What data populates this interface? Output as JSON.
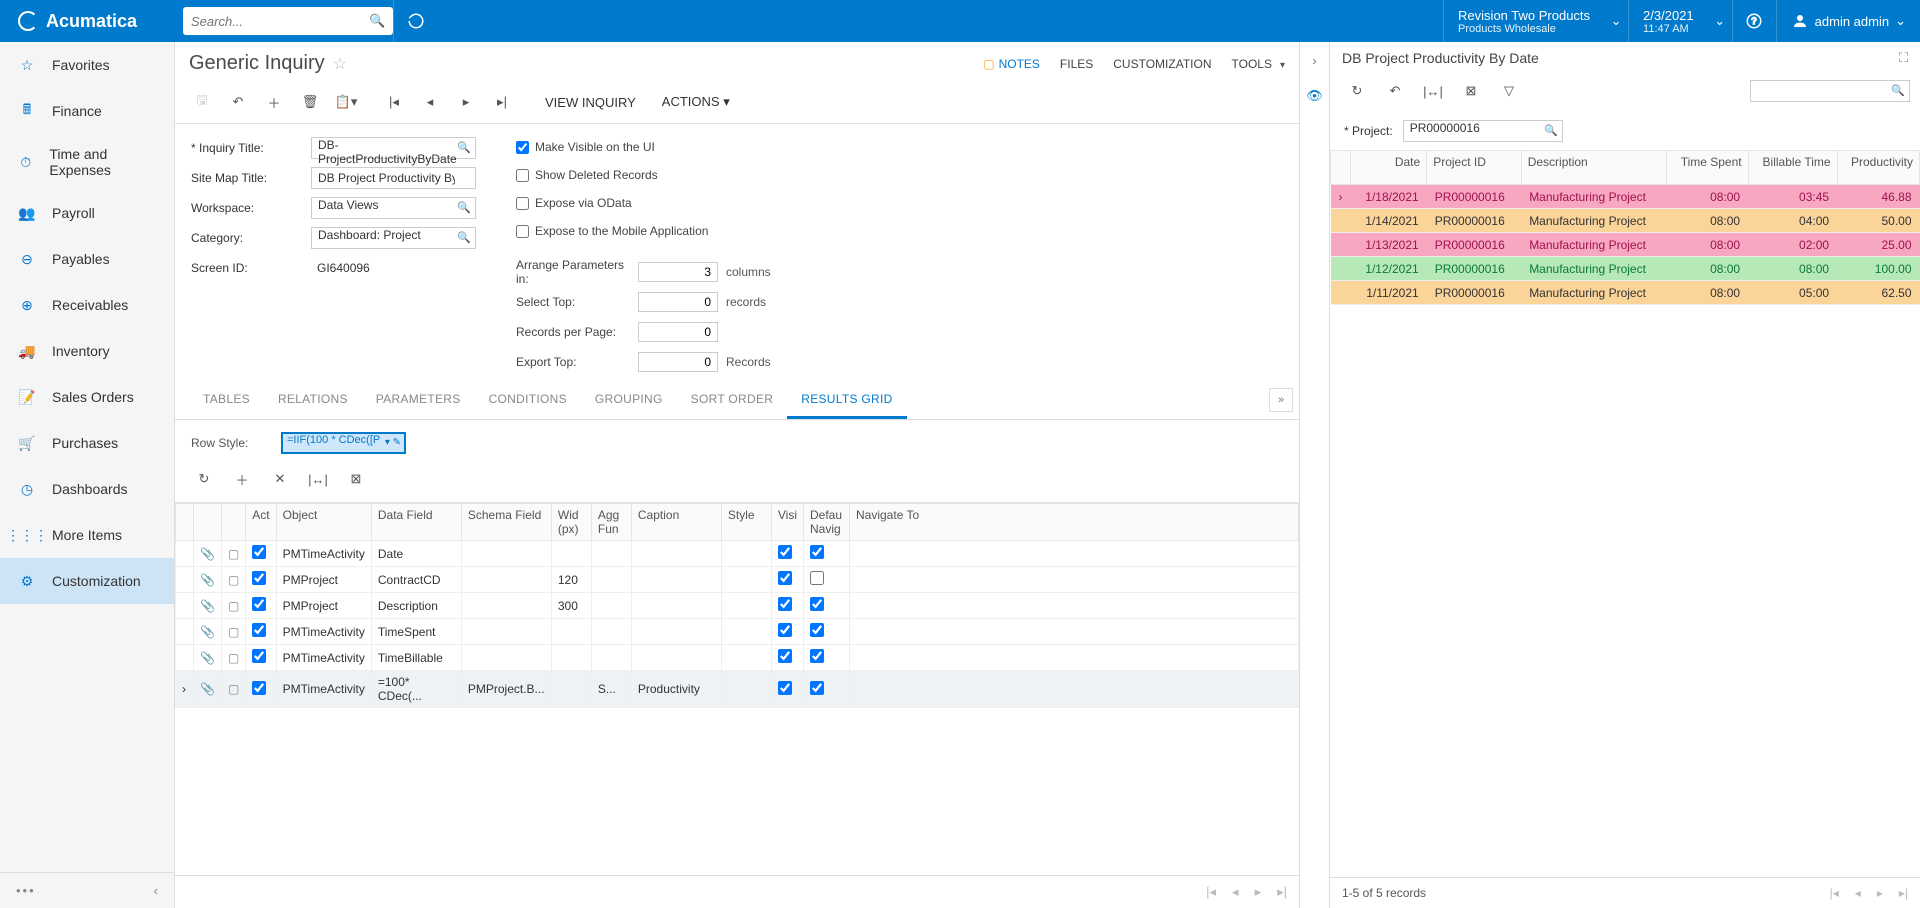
{
  "brand": "Acumatica",
  "search_placeholder": "Search...",
  "tenant": {
    "l1": "Revision Two Products",
    "l2": "Products Wholesale"
  },
  "datetime": {
    "l1": "2/3/2021",
    "l2": "11:47 AM"
  },
  "user": "admin admin",
  "sidebar": [
    {
      "label": "Favorites",
      "icon": "star"
    },
    {
      "label": "Finance",
      "icon": "calc"
    },
    {
      "label": "Time and Expenses",
      "icon": "clock"
    },
    {
      "label": "Payroll",
      "icon": "person"
    },
    {
      "label": "Payables",
      "icon": "minus"
    },
    {
      "label": "Receivables",
      "icon": "plus"
    },
    {
      "label": "Inventory",
      "icon": "truck"
    },
    {
      "label": "Sales Orders",
      "icon": "note"
    },
    {
      "label": "Purchases",
      "icon": "cart"
    },
    {
      "label": "Dashboards",
      "icon": "gauge"
    },
    {
      "label": "More Items",
      "icon": "grid"
    },
    {
      "label": "Customization",
      "icon": "gear",
      "active": true
    }
  ],
  "page": {
    "title": "Generic Inquiry",
    "head_links": {
      "notes": "NOTES",
      "files": "FILES",
      "customization": "CUSTOMIZATION",
      "tools": "TOOLS"
    },
    "toolbar_text": {
      "view": "VIEW INQUIRY",
      "actions": "ACTIONS"
    }
  },
  "form": {
    "inquiry_title_label": "Inquiry Title:",
    "inquiry_title": "DB-ProjectProductivityByDate",
    "sitemap_label": "Site Map Title:",
    "sitemap": "DB Project Productivity By Date",
    "workspace_label": "Workspace:",
    "workspace": "Data Views",
    "category_label": "Category:",
    "category": "Dashboard: Project",
    "screenid_label": "Screen ID:",
    "screenid": "GI640096",
    "chk_visible": "Make Visible on the UI",
    "chk_deleted": "Show Deleted Records",
    "chk_odata": "Expose via OData",
    "chk_mobile": "Expose to the Mobile Application",
    "arrange_label": "Arrange Parameters in:",
    "arrange_val": "3",
    "arrange_suffix": "columns",
    "selecttop_label": "Select Top:",
    "selecttop_val": "0",
    "selecttop_suffix": "records",
    "rpp_label": "Records per Page:",
    "rpp_val": "0",
    "export_label": "Export Top:",
    "export_val": "0",
    "export_suffix": "Records"
  },
  "tabs": [
    "TABLES",
    "RELATIONS",
    "PARAMETERS",
    "CONDITIONS",
    "GROUPING",
    "SORT ORDER",
    "RESULTS GRID"
  ],
  "active_tab": "RESULTS GRID",
  "rowstyle": {
    "label": "Row Style:",
    "value": "=IIF(100 * CDec([P"
  },
  "grid": {
    "headers": [
      "",
      "",
      "",
      "Act",
      "Object",
      "Data Field",
      "Schema Field",
      "Wid (px)",
      "Agg Fun",
      "Caption",
      "Style",
      "Visi",
      "Defau Navig",
      "Navigate To"
    ],
    "rows": [
      {
        "act": true,
        "obj": "PMTimeActivity",
        "df": "Date",
        "sf": "",
        "w": "",
        "agg": "",
        "cap": "",
        "style": "",
        "vis": true,
        "nav": true
      },
      {
        "act": true,
        "obj": "PMProject",
        "df": "ContractCD",
        "sf": "",
        "w": "120",
        "agg": "",
        "cap": "",
        "style": "",
        "vis": true,
        "nav": false
      },
      {
        "act": true,
        "obj": "PMProject",
        "df": "Description",
        "sf": "",
        "w": "300",
        "agg": "",
        "cap": "",
        "style": "",
        "vis": true,
        "nav": true
      },
      {
        "act": true,
        "obj": "PMTimeActivity",
        "df": "TimeSpent",
        "sf": "",
        "w": "",
        "agg": "",
        "cap": "",
        "style": "",
        "vis": true,
        "nav": true
      },
      {
        "act": true,
        "obj": "PMTimeActivity",
        "df": "TimeBillable",
        "sf": "",
        "w": "",
        "agg": "",
        "cap": "",
        "style": "",
        "vis": true,
        "nav": true
      },
      {
        "act": true,
        "obj": "PMTimeActivity",
        "df": "=100* CDec(...",
        "sf": "PMProject.B...",
        "w": "",
        "agg": "S...",
        "cap": "Productivity",
        "style": "",
        "vis": true,
        "nav": true,
        "sel": true
      }
    ]
  },
  "right": {
    "title": "DB Project Productivity By Date",
    "project_label": "Project:",
    "project": "PR00000016",
    "headers": {
      "date": "Date",
      "pid": "Project ID",
      "desc": "Description",
      "ts": "Time Spent",
      "bt": "Billable Time",
      "prod": "Productivity"
    },
    "rows": [
      {
        "cls": "pink",
        "date": "1/18/2021",
        "pid": "PR00000016",
        "desc": "Manufacturing Project",
        "ts": "08:00",
        "bt": "03:45",
        "prod": "46.88"
      },
      {
        "cls": "orange",
        "date": "1/14/2021",
        "pid": "PR00000016",
        "desc": "Manufacturing Project",
        "ts": "08:00",
        "bt": "04:00",
        "prod": "50.00"
      },
      {
        "cls": "pink",
        "date": "1/13/2021",
        "pid": "PR00000016",
        "desc": "Manufacturing Project",
        "ts": "08:00",
        "bt": "02:00",
        "prod": "25.00"
      },
      {
        "cls": "green",
        "date": "1/12/2021",
        "pid": "PR00000016",
        "desc": "Manufacturing Project",
        "ts": "08:00",
        "bt": "08:00",
        "prod": "100.00"
      },
      {
        "cls": "orange",
        "date": "1/11/2021",
        "pid": "PR00000016",
        "desc": "Manufacturing Project",
        "ts": "08:00",
        "bt": "05:00",
        "prod": "62.50"
      }
    ],
    "footer": "1-5 of 5 records"
  }
}
